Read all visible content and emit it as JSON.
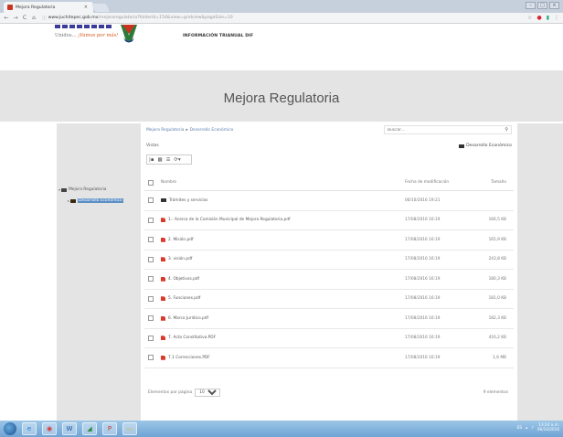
{
  "browser": {
    "tab_title": "Mejora Regulatoria",
    "tab_close": "×",
    "url_host": "www.juchitepec.gob.mx",
    "url_path": "/mejoraregulatoria?folderId=154&view=gridview&pageSize=10",
    "window_controls": [
      "–",
      "□",
      "×"
    ]
  },
  "header": {
    "slogan_prefix": "Unidos... ",
    "slogan_highlight": "¡Vamos por más!",
    "nav_link": "INFORMACIÓN TRIANUAL DIF"
  },
  "banner": {
    "title": "Mejora Regulatoria"
  },
  "tree": {
    "root_label": "Mejora Regulatoria",
    "child_label": "Desarrollo Económico"
  },
  "content": {
    "breadcrumb_root": "Mejora Regulatoria",
    "breadcrumb_sep": "▸",
    "breadcrumb_current": "Desarrollo Económico",
    "search_placeholder": "Buscar...",
    "vistas_label": "Vistas",
    "current_folder": "Desarrollo Económico"
  },
  "table": {
    "headers": {
      "name": "Nombre",
      "date": "Fecha de modificación",
      "size": "Tamaño"
    },
    "rows": [
      {
        "type": "folder",
        "name": "Trámites y servicios",
        "date": "06/10/2016 19:21",
        "size": ""
      },
      {
        "type": "pdf",
        "name": "1.- Acerca de la Comisión Municipal de Mejora Regulatoria.pdf",
        "date": "17/08/2016 16:19",
        "size": "166,5 KB"
      },
      {
        "type": "pdf",
        "name": "2. Misión.pdf",
        "date": "17/08/2016 16:19",
        "size": "165,9 KB"
      },
      {
        "type": "pdf",
        "name": "3. visión.pdf",
        "date": "17/08/2016 16:19",
        "size": "243,8 KB"
      },
      {
        "type": "pdf",
        "name": "4. Objetivos.pdf",
        "date": "17/08/2016 16:19",
        "size": "180,3 KB"
      },
      {
        "type": "pdf",
        "name": "5. Funciones.pdf",
        "date": "17/08/2016 16:19",
        "size": "181,0 KB"
      },
      {
        "type": "pdf",
        "name": "6. Marco Jurídico.pdf",
        "date": "17/08/2016 16:19",
        "size": "182,3 KB"
      },
      {
        "type": "pdf",
        "name": "7. Acta Constitutiva.PDF",
        "date": "17/08/2016 16:19",
        "size": "416,2 KB"
      },
      {
        "type": "pdf",
        "name": "7.1 Correcciones.PDF",
        "date": "17/08/2016 16:19",
        "size": "1,6 MB"
      }
    ]
  },
  "footer": {
    "per_page_label": "Elementos por página",
    "per_page_value": "10",
    "count": "9 elementos"
  },
  "taskbar": {
    "clock_time": "13:24 a.m.",
    "clock_date": "06/10/2016"
  },
  "colors": {
    "accent_link": "#5b7fb0",
    "banner_bg": "#e4e4e4",
    "pdf_icon": "#d93a2b"
  }
}
